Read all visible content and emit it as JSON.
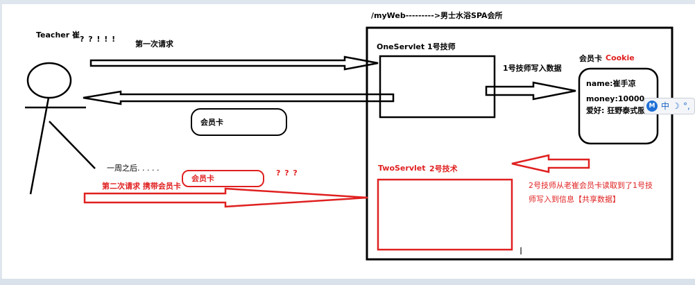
{
  "texts": {
    "title": "/myWeb--------->男士水浴SPA会所",
    "teacher": "Teacher 崔",
    "question_marks": "? ? ! ! !",
    "first_request": "第一次请求",
    "member_card_1": "会员卡",
    "one_week_later": "一周之后. . . . .",
    "second_request": "第二次请求 携带会员卡",
    "member_card_2": "会员卡",
    "question_marks_2": "? ? ?",
    "one_servlet": "OneServlet  1号技师",
    "write_data": "1号技师写入数据",
    "cookie_label": "会员卡",
    "cookie_word": "Cookie",
    "card_name": "name:崔手凉",
    "card_money": "money:10000",
    "card_hobby": "爱好: 狂野泰式服务",
    "two_servlet": "TwoServlet",
    "two_servlet_tech": "2号技术",
    "shared_info_1": "2号技师从老崔会员卡读取到了1号技",
    "shared_info_2": "师写入到信息【共享数据】"
  },
  "ime": {
    "logo": "M",
    "lang": "中",
    "moon": "☽",
    "dot": "°,"
  },
  "cursor": "I",
  "colors": {
    "black": "#000000",
    "red": "#e02020"
  }
}
